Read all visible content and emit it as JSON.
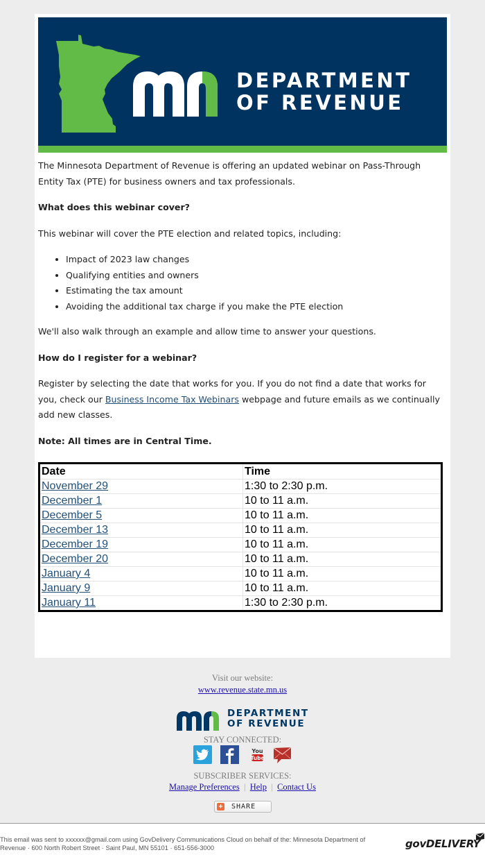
{
  "banner": {
    "logo_letters": "mn",
    "dept_line1": "DEPARTMENT",
    "dept_line2": "OF REVENUE",
    "colors": {
      "navy": "#00335f",
      "green": "#62bb46"
    }
  },
  "body": {
    "intro": "The Minnesota Department of Revenue is offering an updated webinar on Pass-Through Entity Tax (PTE) for business owners and tax professionals.",
    "heading_cover": "What does this webinar cover?",
    "cover_text": "This webinar will cover the PTE election and related topics, including:",
    "topics": [
      "Impact of 2023 law changes",
      "Qualifying entities and owners",
      "Estimating the tax amount",
      "Avoiding the additional tax charge if you make the PTE election"
    ],
    "walkthrough": "We'll also walk through an example and allow time to answer your questions.",
    "heading_register": "How do I register for a webinar?",
    "register_pre": "Register by selecting the date that works for you. If you do not find a date that works for you, check our ",
    "register_link": "Business Income Tax Webinars",
    "register_post": " webpage and future emails as we continually add new classes.",
    "note": "Note: All times are in Central Time."
  },
  "schedule": {
    "headers": {
      "date": "Date",
      "time": "Time"
    },
    "rows": [
      {
        "date": "November 29",
        "time": "1:30 to 2:30 p.m."
      },
      {
        "date": "December 1",
        "time": "10 to 11 a.m."
      },
      {
        "date": "December 5",
        "time": "10 to 11 a.m."
      },
      {
        "date": "December 13",
        "time": "10 to 11 a.m."
      },
      {
        "date": "December 19",
        "time": "10 to 11 a.m."
      },
      {
        "date": "December 20",
        "time": "10 to 11 a.m."
      },
      {
        "date": "January 4",
        "time": "10 to 11 a.m."
      },
      {
        "date": "January 9",
        "time": "10 to 11 a.m."
      },
      {
        "date": "January 11",
        "time": "1:30 to 2:30 p.m."
      }
    ]
  },
  "footer": {
    "visit_label": "Visit our website:",
    "website_link": "www.revenue.state.mn.us",
    "small_logo_line1": "DEPARTMENT",
    "small_logo_line2": "OF REVENUE",
    "stay_connected": "STAY CONNECTED:",
    "social": [
      "twitter-icon",
      "facebook-icon",
      "youtube-icon",
      "email-icon"
    ],
    "youtube_top": "You",
    "youtube_bottom": "Tube",
    "subscriber_services": "SUBSCRIBER SERVICES:",
    "links": {
      "manage": "Manage Preferences",
      "sep": "|",
      "help": "Help",
      "contact": "Contact Us"
    },
    "share_label": "SHARE",
    "share_plus": "+",
    "legal_line1": "This email was sent to xxxxxx@gmail.com using GovDelivery Communications Cloud on behalf of the: Minnesota Department of",
    "legal_line2": "Revenue · 600 North Robert Street · Saint Paul, MN 55101 · 651-556-3000",
    "govdelivery": "govDELIVERY"
  }
}
